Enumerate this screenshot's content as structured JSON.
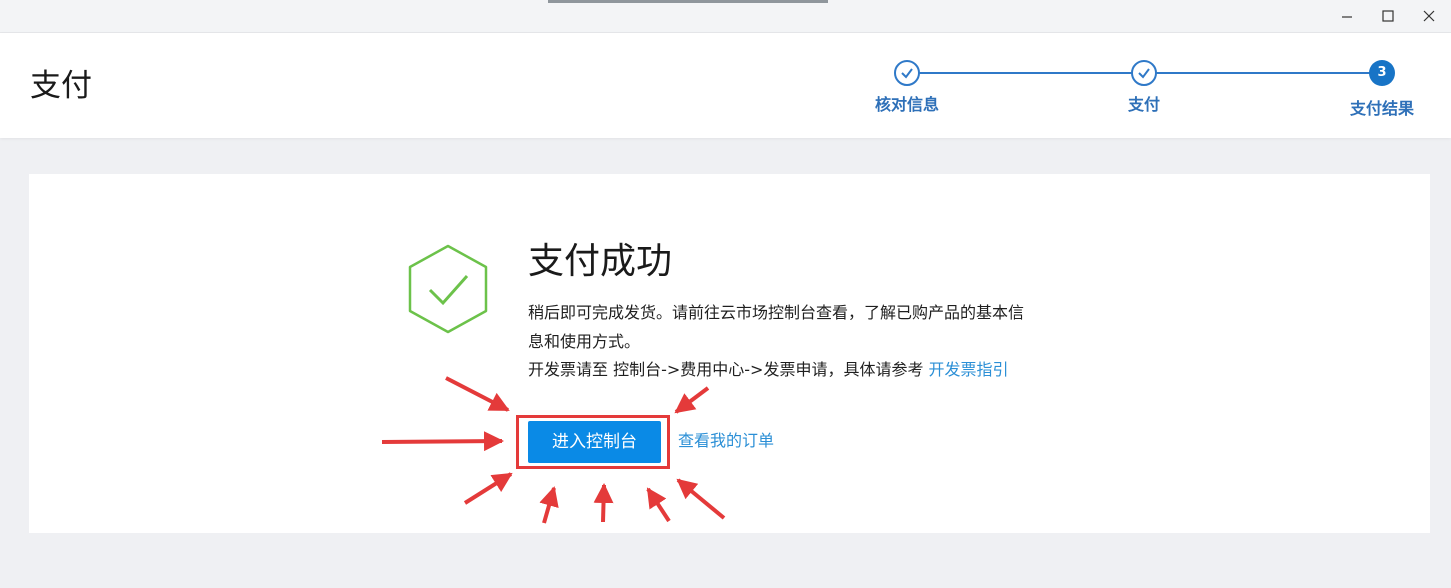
{
  "window": {
    "minimize_icon": "minimize-icon",
    "maximize_icon": "maximize-icon",
    "close_icon": "close-icon"
  },
  "header": {
    "title": "支付",
    "steps": [
      {
        "label": "核对信息",
        "state": "done"
      },
      {
        "label": "支付",
        "state": "done"
      },
      {
        "label": "支付结果",
        "state": "current",
        "number": "3"
      }
    ]
  },
  "result": {
    "title": "支付成功",
    "line1": "稍后即可完成发货。请前往云市场控制台查看，了解已购产品的基本信",
    "line2": "息和使用方式。",
    "line3_prefix": "开发票请至 控制台->费用中心->发票申请，具体请参考 ",
    "invoice_link": "开发票指引",
    "console_button": "进入控制台",
    "orders_link": "查看我的订单"
  },
  "colors": {
    "accent": "#1874c6",
    "button": "#0a8ae6",
    "link": "#2b8fd6",
    "success": "#6cc24a",
    "annotation": "#e43a3a"
  }
}
